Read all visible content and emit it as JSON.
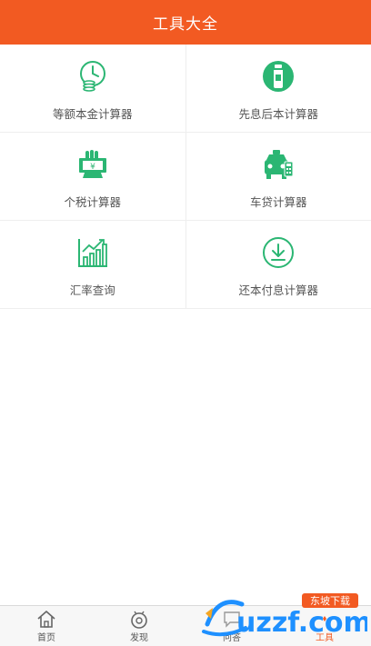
{
  "header": {
    "title": "工具大全"
  },
  "tools": [
    {
      "label": "等额本金计算器",
      "icon": "clock-coins-icon"
    },
    {
      "label": "先息后本计算器",
      "icon": "bottle-icon"
    },
    {
      "label": "个税计算器",
      "icon": "yuan-bill-icon"
    },
    {
      "label": "车贷计算器",
      "icon": "car-icon"
    },
    {
      "label": "汇率查询",
      "icon": "bar-chart-icon"
    },
    {
      "label": "还本付息计算器",
      "icon": "download-circle-icon"
    }
  ],
  "tabbar": {
    "tabs": [
      {
        "label": "首页",
        "icon": "home-icon"
      },
      {
        "label": "发现",
        "icon": "discover-icon"
      },
      {
        "label": "问答",
        "icon": "qa-icon"
      },
      {
        "label": "工具",
        "icon": "tools-icon",
        "active": true
      }
    ]
  },
  "watermark": {
    "text": "uzzf.com",
    "subtext": "东坡下载"
  },
  "colors": {
    "accent": "#f25a22",
    "icon_green": "#2bb673"
  }
}
